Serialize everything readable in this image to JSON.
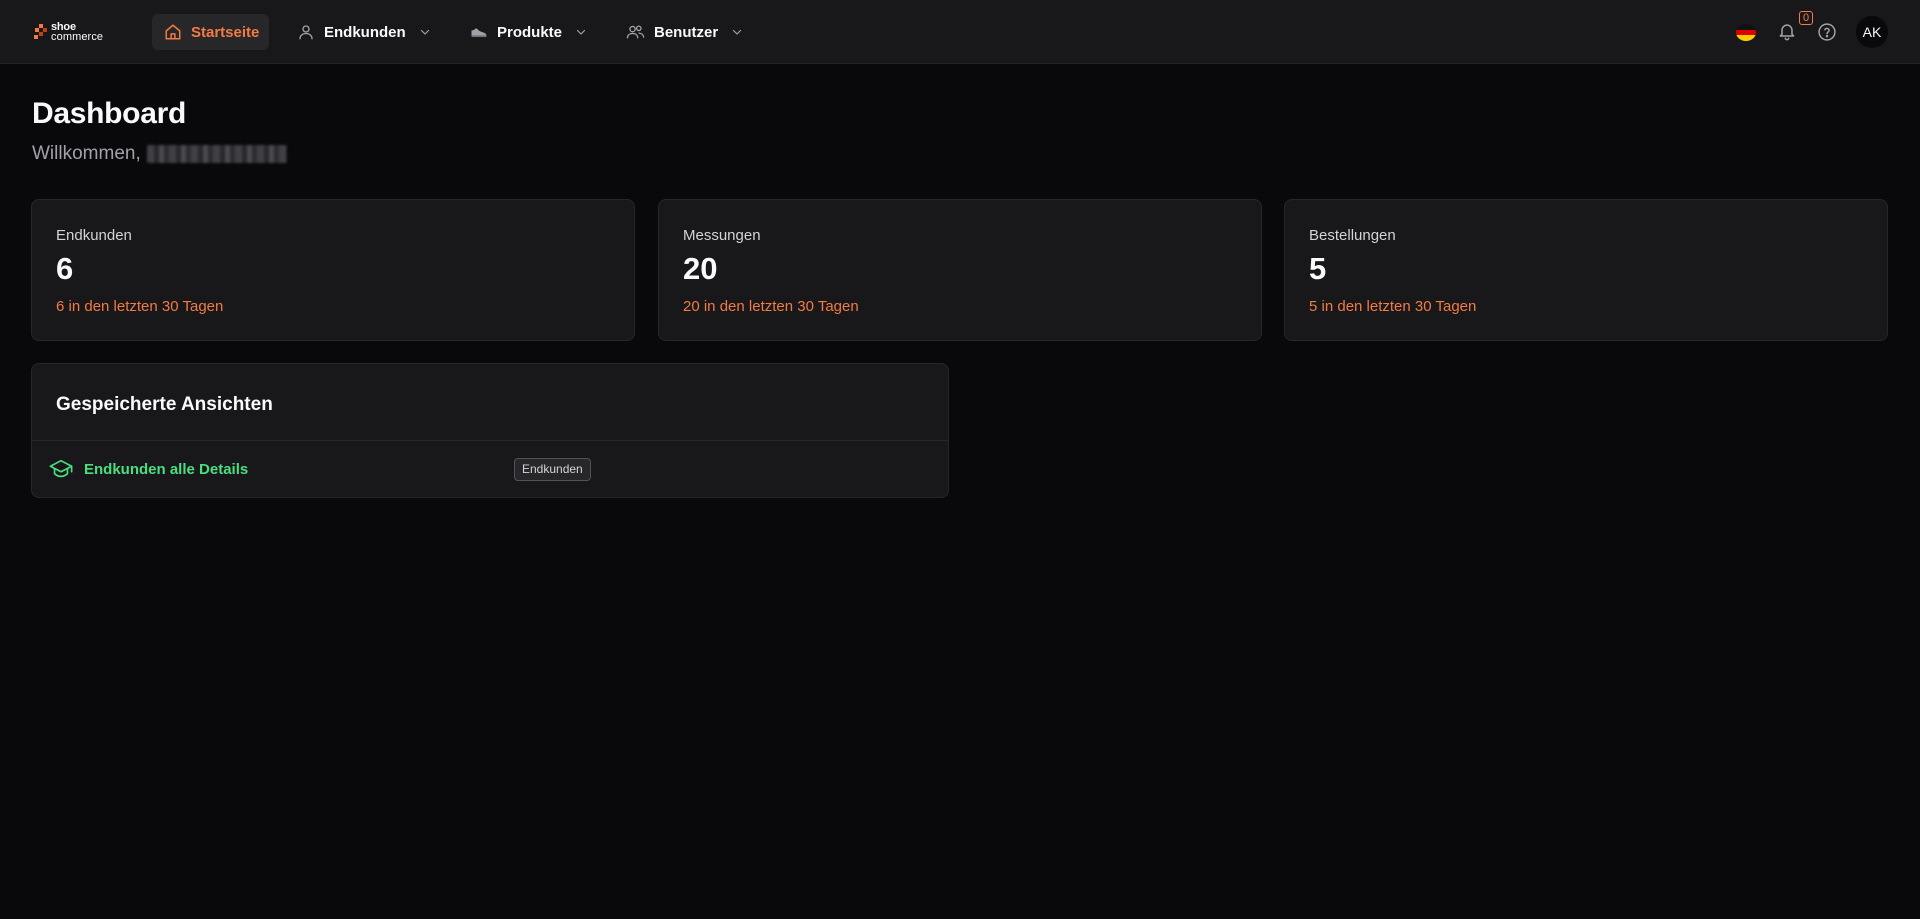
{
  "brand": {
    "line1": "shoe",
    "line2": "commerce",
    "accent": "#f27a45"
  },
  "nav": {
    "items": [
      {
        "label": "Startseite",
        "icon": "home-icon",
        "active": true
      },
      {
        "label": "Endkunden",
        "icon": "user-icon",
        "active": false
      },
      {
        "label": "Produkte",
        "icon": "shoe-icon",
        "active": false
      },
      {
        "label": "Benutzer",
        "icon": "users-icon",
        "active": false
      }
    ]
  },
  "header_right": {
    "language_flag": "germany-flag-icon",
    "notifications_count": "0",
    "avatar_initials": "AK"
  },
  "page": {
    "title": "Dashboard",
    "welcome": "Willkommen,"
  },
  "stats": [
    {
      "label": "Endkunden",
      "value": "6",
      "sub": "6 in den letzten 30 Tagen"
    },
    {
      "label": "Messungen",
      "value": "20",
      "sub": "20 in den letzten 30 Tagen"
    },
    {
      "label": "Bestellungen",
      "value": "5",
      "sub": "5 in den letzten 30 Tagen"
    }
  ],
  "saved_views": {
    "title": "Gespeicherte Ansichten",
    "items": [
      {
        "label": "Endkunden alle Details",
        "tag": "Endkunden",
        "color": "#4ade80"
      }
    ]
  }
}
